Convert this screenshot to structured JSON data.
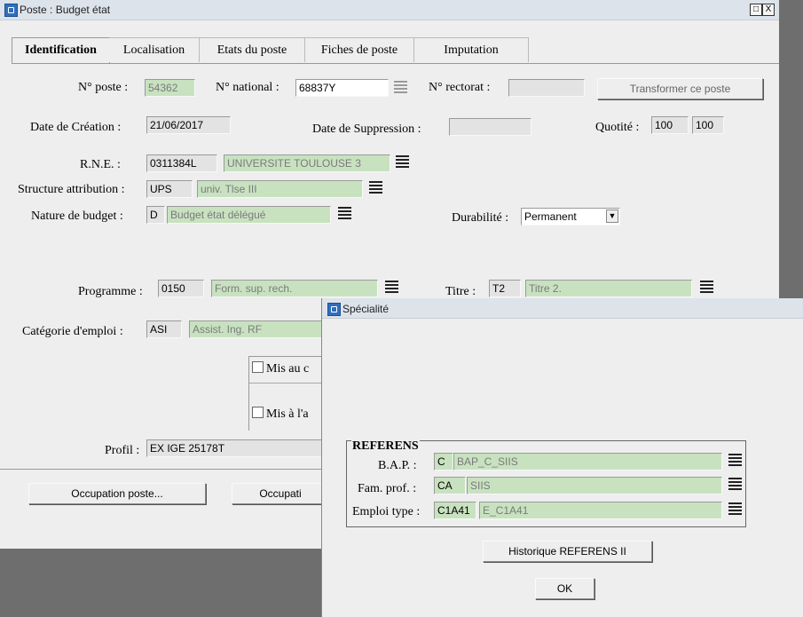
{
  "main_window": {
    "title": "Poste : Budget état",
    "window_buttons": [
      "□",
      "X"
    ],
    "tabs": [
      "Identification",
      "Localisation",
      "Etats du poste",
      "Fiches de poste",
      "Imputation"
    ],
    "fields": {
      "no_poste_label": "N° poste :",
      "no_poste_value": "54362",
      "no_national_label": "N° national :",
      "no_national_value": "68837Y",
      "no_rectorat_label": "N° rectorat :",
      "no_rectorat_value": "",
      "transformer_button": "Transformer ce poste",
      "date_creation_label": "Date de Création :",
      "date_creation_value": "21/06/2017",
      "date_suppression_label": "Date de Suppression :",
      "date_suppression_value": "",
      "quotite_label": "Quotité :",
      "quotite_value1": "100",
      "quotite_value2": "100",
      "rne_label": "R.N.E. :",
      "rne_code": "0311384L",
      "rne_name": "UNIVERSITE TOULOUSE 3",
      "structure_label": "Structure attribution :",
      "structure_code": "UPS",
      "structure_name": "univ. Tlse III",
      "nature_label": "Nature de budget :",
      "nature_code": "D",
      "nature_name": "Budget état délégué",
      "durabilite_label": "Durabilité :",
      "durabilite_value": "Permanent",
      "programme_label": "Programme :",
      "programme_code": "0150",
      "programme_name": "Form. sup. rech.",
      "titre_label": "Titre :",
      "titre_code": "T2",
      "titre_name": "Titre 2.",
      "categorie_label": "Catégorie d'emploi :",
      "categorie_code": "ASI",
      "categorie_name": "Assist. Ing. RF",
      "mis_au_label": "Mis au c",
      "mis_a_label": "Mis à l'a",
      "profil_label": "Profil :",
      "profil_value": "EX IGE 25178T"
    },
    "buttons": {
      "occupation_poste": "Occupation poste...",
      "occupation2": "Occupati"
    }
  },
  "specialite_dialog": {
    "title": "Spécialité",
    "group_title": "REFERENS",
    "bap_label": "B.A.P. :",
    "bap_code": "C",
    "bap_name": "BAP_C_SIIS",
    "fam_label": "Fam. prof. :",
    "fam_code": "CA",
    "fam_name": "SIIS",
    "emploi_label": "Emploi type :",
    "emploi_code": "C1A41",
    "emploi_name": "E_C1A41",
    "historique_button": "Historique REFERENS II",
    "ok_button": "OK"
  }
}
